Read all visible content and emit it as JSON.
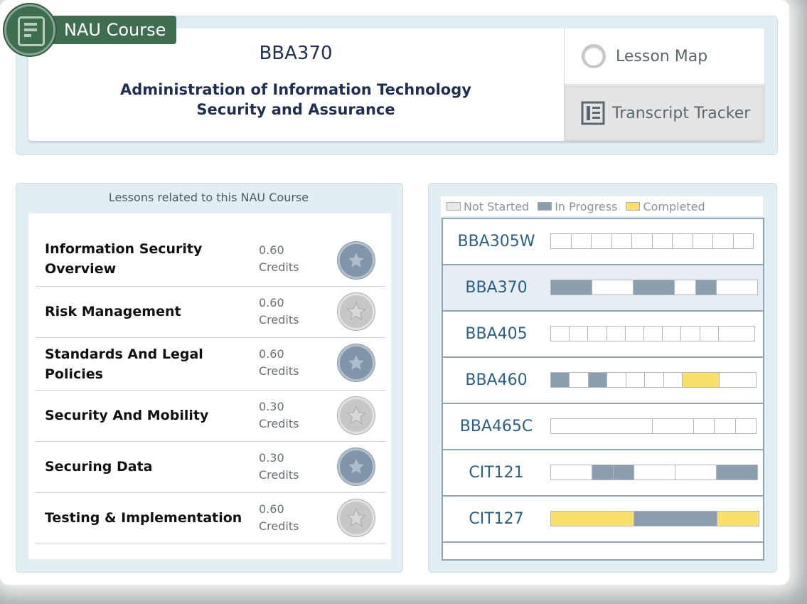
{
  "badge": {
    "label": "NAU Course"
  },
  "header": {
    "course_code": "BBA370",
    "course_title": "Administration of Information Technology\nSecurity and Assurance"
  },
  "nav": {
    "lesson_map": "Lesson Map",
    "transcript_tracker": "Transcript Tracker"
  },
  "lessons": {
    "heading": "Lessons related to this NAU Course",
    "items": [
      {
        "name": "Information Security\nOverview",
        "credits_value": "0.60",
        "credits_unit": "Credits",
        "status": "completed"
      },
      {
        "name": "Risk Management",
        "credits_value": "0.60",
        "credits_unit": "Credits",
        "status": "not-completed"
      },
      {
        "name": "Standards And Legal\nPolicies",
        "credits_value": "0.60",
        "credits_unit": "Credits",
        "status": "completed"
      },
      {
        "name": "Security And Mobility",
        "credits_value": "0.30",
        "credits_unit": "Credits",
        "status": "not-completed"
      },
      {
        "name": "Securing Data",
        "credits_value": "0.30",
        "credits_unit": "Credits",
        "status": "completed"
      },
      {
        "name": "Testing & Implementation",
        "credits_value": "0.60",
        "credits_unit": "Credits",
        "status": "not-completed"
      }
    ]
  },
  "legend": {
    "not_started": "Not Started",
    "in_progress": "In Progress",
    "completed": "Completed"
  },
  "colors": {
    "not_started": "#ffffff",
    "in_progress": "#8a9eae",
    "completed": "#f8e06a",
    "accent_green": "#3e6d50",
    "navy_text": "#1f2e52",
    "course_link": "#2a5f86"
  },
  "courses": [
    {
      "code": "BBA305W",
      "current": false,
      "segments": [
        "not_started",
        "not_started",
        "not_started",
        "not_started",
        "not_started",
        "not_started",
        "not_started",
        "not_started",
        "not_started",
        "not_started"
      ]
    },
    {
      "code": "BBA370",
      "current": true,
      "segments": [
        "in_progress",
        "not_started",
        "in_progress",
        "not_started",
        "in_progress",
        "not_started"
      ]
    },
    {
      "code": "BBA405",
      "current": false,
      "segments": [
        "not_started",
        "not_started",
        "not_started",
        "not_started",
        "not_started",
        "not_started",
        "not_started",
        "not_started",
        "not_started",
        "not_started"
      ]
    },
    {
      "code": "BBA460",
      "current": false,
      "segments": [
        "in_progress",
        "not_started",
        "in_progress",
        "not_started",
        "not_started",
        "not_started",
        "not_started",
        "completed",
        "not_started"
      ]
    },
    {
      "code": "BBA465C",
      "current": false,
      "segments": [
        "not_started",
        "not_started",
        "not_started",
        "not_started",
        "not_started"
      ]
    },
    {
      "code": "CIT121",
      "current": false,
      "segments": [
        "not_started",
        "in_progress",
        "in_progress",
        "not_started",
        "not_started",
        "in_progress"
      ]
    },
    {
      "code": "CIT127",
      "current": false,
      "segments": [
        "completed",
        "in_progress",
        "completed"
      ]
    }
  ]
}
